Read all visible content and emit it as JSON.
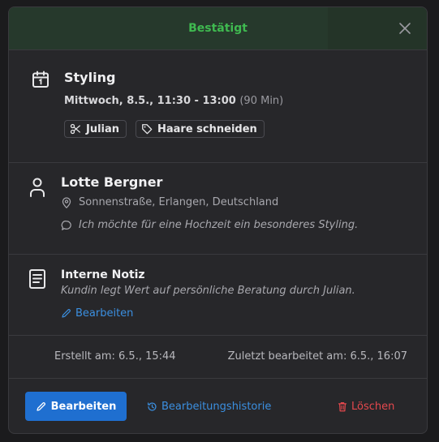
{
  "header": {
    "status_label": "Bestätigt",
    "status_color": "#3fb950"
  },
  "appointment": {
    "service": "Styling",
    "datetime": "Mittwoch, 8.5., 11:30 - 13:00",
    "duration": "(90 Min)",
    "chips": [
      {
        "icon": "scissors-icon",
        "label": "Julian"
      },
      {
        "icon": "tag-icon",
        "label": "Haare schneiden"
      }
    ]
  },
  "customer": {
    "name": "Lotte Bergner",
    "address": "Sonnenstraße, Erlangen, Deutschland",
    "message": "Ich möchte für eine Hochzeit ein besonderes Styling."
  },
  "note": {
    "heading": "Interne Notiz",
    "text": "Kundin legt Wert auf persönliche Beratung durch Julian.",
    "edit_label": "Bearbeiten"
  },
  "meta": {
    "created": "Erstellt am: 6.5., 15:44",
    "updated": "Zuletzt bearbeitet am: 6.5., 16:07"
  },
  "footer": {
    "edit_label": "Bearbeiten",
    "history_label": "Bearbeitungshistorie",
    "delete_label": "Löschen"
  },
  "colors": {
    "accent": "#1f6fd0",
    "link": "#3b8fe0",
    "danger": "#e5484d",
    "success": "#3fb950"
  }
}
